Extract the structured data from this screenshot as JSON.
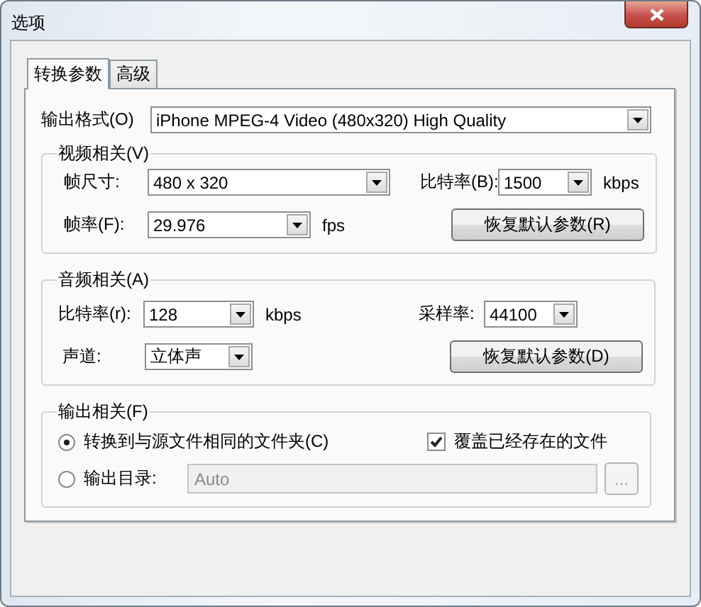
{
  "window": {
    "title": "选项"
  },
  "tabs": [
    {
      "label": "转换参数",
      "selected": true
    },
    {
      "label": "高级",
      "selected": false
    }
  ],
  "output_format": {
    "label": "输出格式(O)",
    "value": "iPhone MPEG-4 Video (480x320) High Quality"
  },
  "video": {
    "title": "视频相关(V)",
    "frame_size": {
      "label": "帧尺寸:",
      "value": "480 x 320"
    },
    "bitrate": {
      "label": "比特率(B):",
      "value": "1500",
      "unit": "kbps"
    },
    "frame_rate": {
      "label": "帧率(F):",
      "value": "29.976",
      "unit": "fps"
    },
    "reset_button": "恢复默认参数(R)"
  },
  "audio": {
    "title": "音频相关(A)",
    "bitrate": {
      "label": "比特率(r):",
      "value": "128",
      "unit": "kbps"
    },
    "sample_rate": {
      "label": "采样率:",
      "value": "44100"
    },
    "channels": {
      "label": "声道:",
      "value": "立体声"
    },
    "reset_button": "恢复默认参数(D)"
  },
  "output": {
    "title": "输出相关(F)",
    "options": [
      {
        "label": "转换到与源文件相同的文件夹(C)",
        "selected": true
      },
      {
        "label": "输出目录:",
        "selected": false
      }
    ],
    "overwrite": {
      "label": "覆盖已经存在的文件",
      "checked": true
    },
    "directory": {
      "value": "Auto",
      "disabled": true
    },
    "browse_button": {
      "label": "...",
      "disabled": true
    }
  }
}
